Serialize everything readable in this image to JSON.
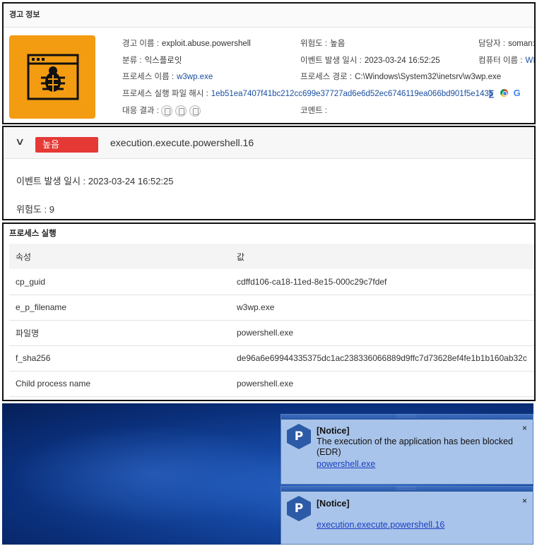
{
  "alert_info": {
    "title": "경고 정보",
    "fields": {
      "alert_name_label": "경고 이름 :",
      "alert_name_value": "exploit.abuse.powershell",
      "severity_label": "위험도 :",
      "severity_value": "높음",
      "assignee_label": "담당자 :",
      "assignee_value": "soman:",
      "category_label": "분류 :",
      "category_value": "익스플로잇",
      "event_time_label": "이벤트 발생 일시 :",
      "event_time_value": "2023-03-24 16:52:25",
      "computer_label": "컴퓨터 이름 :",
      "computer_value": "WI",
      "process_name_label": "프로세스 이름 :",
      "process_name_value": "w3wp.exe",
      "process_path_label": "프로세스 경로 :",
      "process_path_value": "C:\\Windows\\System32\\inetsrv\\w3wp.exe",
      "process_hash_label": "프로세스 실행 파일 해시 :",
      "process_hash_value": "1eb51ea7407f41bc212cc699e37727ad6e6d52ec6746119ea066bd901f5e143b",
      "response_label": "대응 결과 :",
      "comment_label": "코멘트 :"
    },
    "icons": [
      "bug-window-icon",
      "sigma-icon",
      "chrome-icon",
      "google-icon"
    ],
    "accent_color": "#f39c12"
  },
  "detection": {
    "severity_badge": "높음",
    "badge_color": "#e53935",
    "rule_name": "execution.execute.powershell.16",
    "event_time_line": "이벤트 발생 일시 : 2023-03-24 16:52:25",
    "risk_line": "위험도 : 9"
  },
  "process_exec": {
    "title": "프로세스 실행",
    "columns": [
      "속성",
      "값"
    ],
    "rows": [
      [
        "cp_guid",
        "cdffd106-ca18-11ed-8e15-000c29c7fdef"
      ],
      [
        "e_p_filename",
        "w3wp.exe"
      ],
      [
        "파일명",
        "powershell.exe"
      ],
      [
        "f_sha256",
        "de96a6e69944335375dc1ac238336066889d9ffc7d73628ef4fe1b1b160ab32c"
      ],
      [
        "Child process name",
        "powershell.exe"
      ]
    ]
  },
  "notifications": [
    {
      "icon_letter": "P",
      "title": "[Notice]",
      "message": "The execution of the application has been blocked(EDR)",
      "link": "powershell.exe",
      "close": "×"
    },
    {
      "icon_letter": "P",
      "title": "[Notice]",
      "message": "",
      "link": "execution.execute.powershell.16",
      "close": "×"
    }
  ]
}
